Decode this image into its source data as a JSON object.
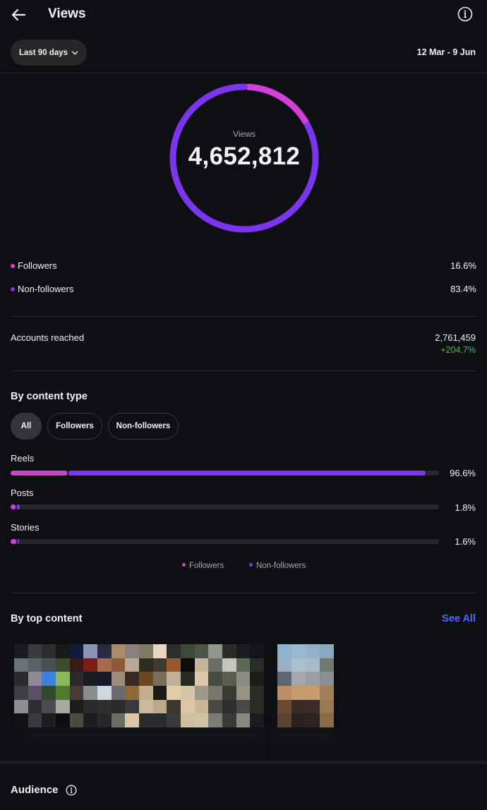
{
  "header": {
    "title": "Views",
    "back_icon": "arrow-left-icon",
    "info_icon": "info-circle-icon"
  },
  "filter": {
    "range_label": "Last 90 days",
    "date_range": "12 Mar - 9 Jun"
  },
  "views": {
    "label": "Views",
    "total": "4,652,812"
  },
  "audience_split": [
    {
      "label": "Followers",
      "percent": "16.6%",
      "fraction": 0.166,
      "color": "#d23fd9"
    },
    {
      "label": "Non-followers",
      "percent": "83.4%",
      "fraction": 0.834,
      "color": "#7b35ef"
    }
  ],
  "reach": {
    "label": "Accounts reached",
    "value": "2,761,459",
    "change": "+204.7%"
  },
  "by_content_type": {
    "title": "By content type",
    "chips": [
      "All",
      "Followers",
      "Non-followers"
    ],
    "active_chip": "All",
    "rows": [
      {
        "label": "Reels",
        "percent": "96.6%",
        "followers_fraction": 0.132,
        "non_followers_fraction": 0.834
      },
      {
        "label": "Posts",
        "percent": "1.8%",
        "followers_fraction": 0.012,
        "non_followers_fraction": 0.006
      },
      {
        "label": "Stories",
        "percent": "1.6%",
        "followers_fraction": 0.013,
        "non_followers_fraction": 0.003
      }
    ],
    "legend": [
      "Followers",
      "Non-followers"
    ]
  },
  "top_content": {
    "title": "By top content",
    "see_all": "See All"
  },
  "audience": {
    "title": "Audience"
  },
  "colors": {
    "followers": "#d23fd9",
    "non_followers": "#7b35ef",
    "positive": "#3fb95a",
    "link": "#4b6bff"
  }
}
